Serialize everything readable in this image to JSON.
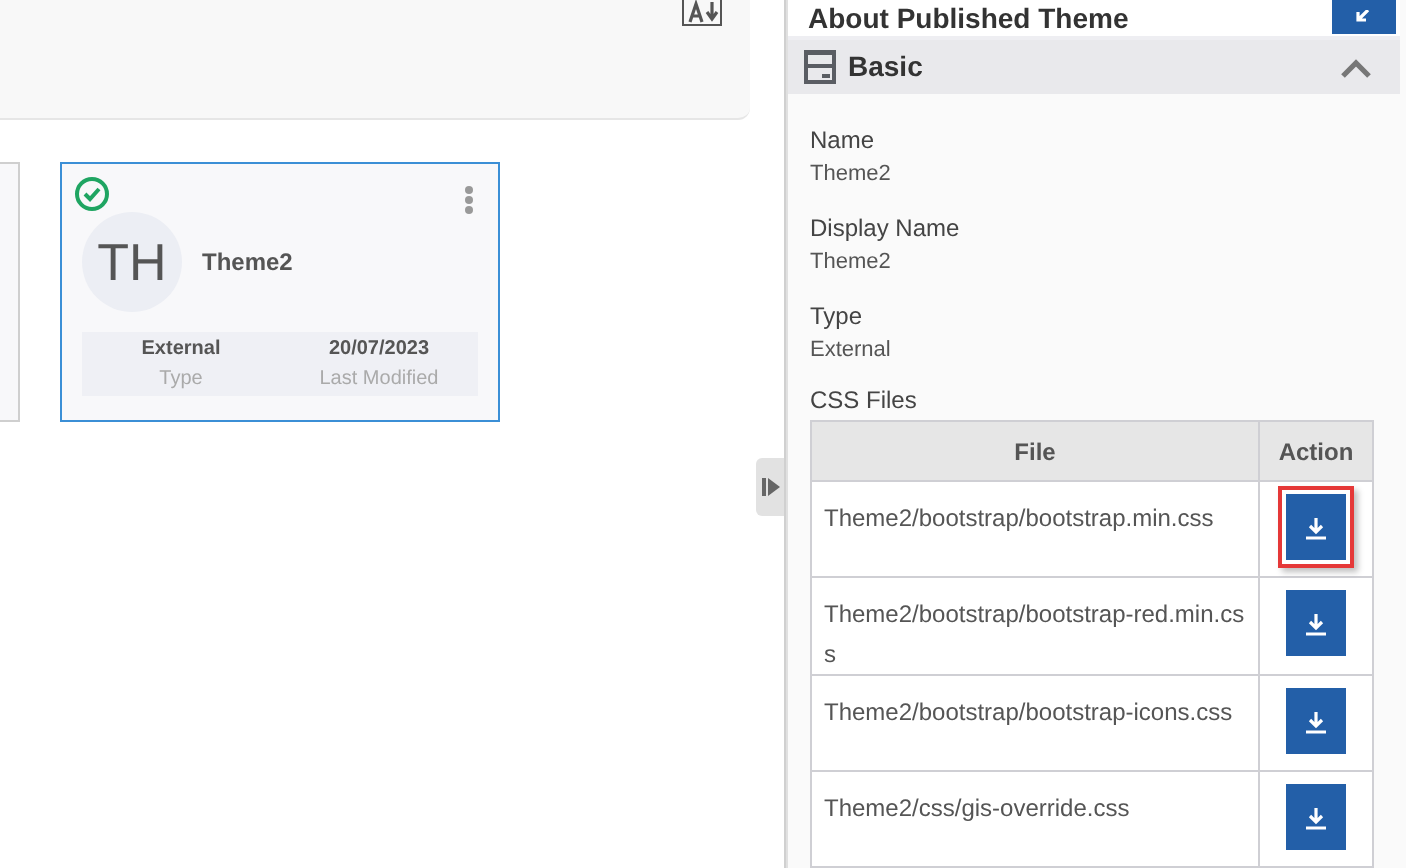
{
  "theme_card": {
    "name": "Theme2",
    "initials": "TH",
    "published": true,
    "type_value": "External",
    "type_label": "Type",
    "modified_value": "20/07/2023",
    "modified_label": "Last Modified",
    "selected": true
  },
  "panel": {
    "title": "About Published Theme",
    "section": {
      "title": "Basic",
      "expanded": true,
      "fields": [
        {
          "label": "Name",
          "value": "Theme2"
        },
        {
          "label": "Display Name",
          "value": "Theme2"
        },
        {
          "label": "Type",
          "value": "External"
        }
      ],
      "files_label": "CSS Files",
      "columns": [
        "File",
        "Action"
      ],
      "rows": [
        {
          "file": "Theme2/bootstrap/bootstrap.min.css",
          "highlighted": true
        },
        {
          "file": "Theme2/bootstrap/bootstrap-red.min.css",
          "highlighted": false
        },
        {
          "file": "Theme2/bootstrap/bootstrap-icons.css",
          "highlighted": false
        },
        {
          "file": "Theme2/css/gis-override.css",
          "highlighted": false
        }
      ]
    }
  }
}
